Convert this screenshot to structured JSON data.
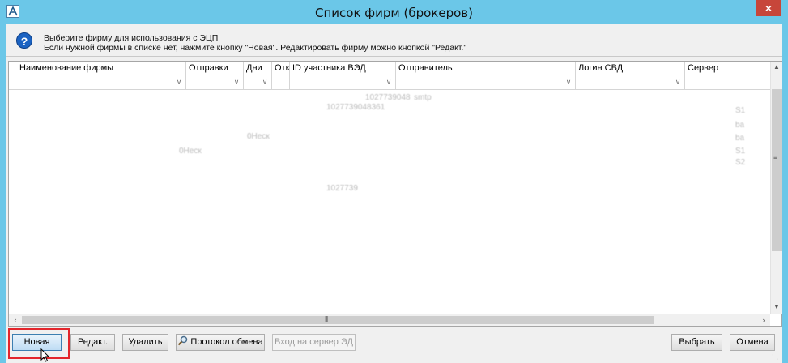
{
  "window": {
    "title": "Список фирм (брокеров)",
    "close_label": "×"
  },
  "info": {
    "line1": "Выберите фирму для использования с ЭЦП",
    "line2": "Если нужной фирмы в списке нет, нажмите кнопку \"Новая\". Редактировать фирму можно кнопкой \"Редакт.\""
  },
  "grid": {
    "columns": [
      {
        "label": "Наименование фирмы"
      },
      {
        "label": "Отправки"
      },
      {
        "label": "Дни"
      },
      {
        "label": "Отк"
      },
      {
        "label": "ID участника ВЭД"
      },
      {
        "label": "Отправитель"
      },
      {
        "label": "Логин СВД"
      },
      {
        "label": "Сервер"
      }
    ],
    "blurred_fragments": [
      "1027739048",
      "smtp",
      "1027739048361",
      "0Неск",
      "0Неск",
      "1027739",
      "ba",
      "ba",
      "S1",
      "S1",
      "S2"
    ]
  },
  "buttons": {
    "new": "Новая",
    "edit": "Редакт.",
    "delete": "Удалить",
    "protocol": "Протокол обмена",
    "login_server": "Вход на сервер ЭД",
    "select": "Выбрать",
    "cancel": "Отмена"
  },
  "colors": {
    "title_bar": "#6bc7e8",
    "close_button": "#c7463a",
    "highlight": "#e3262c",
    "help_icon": "#1a62c2"
  }
}
